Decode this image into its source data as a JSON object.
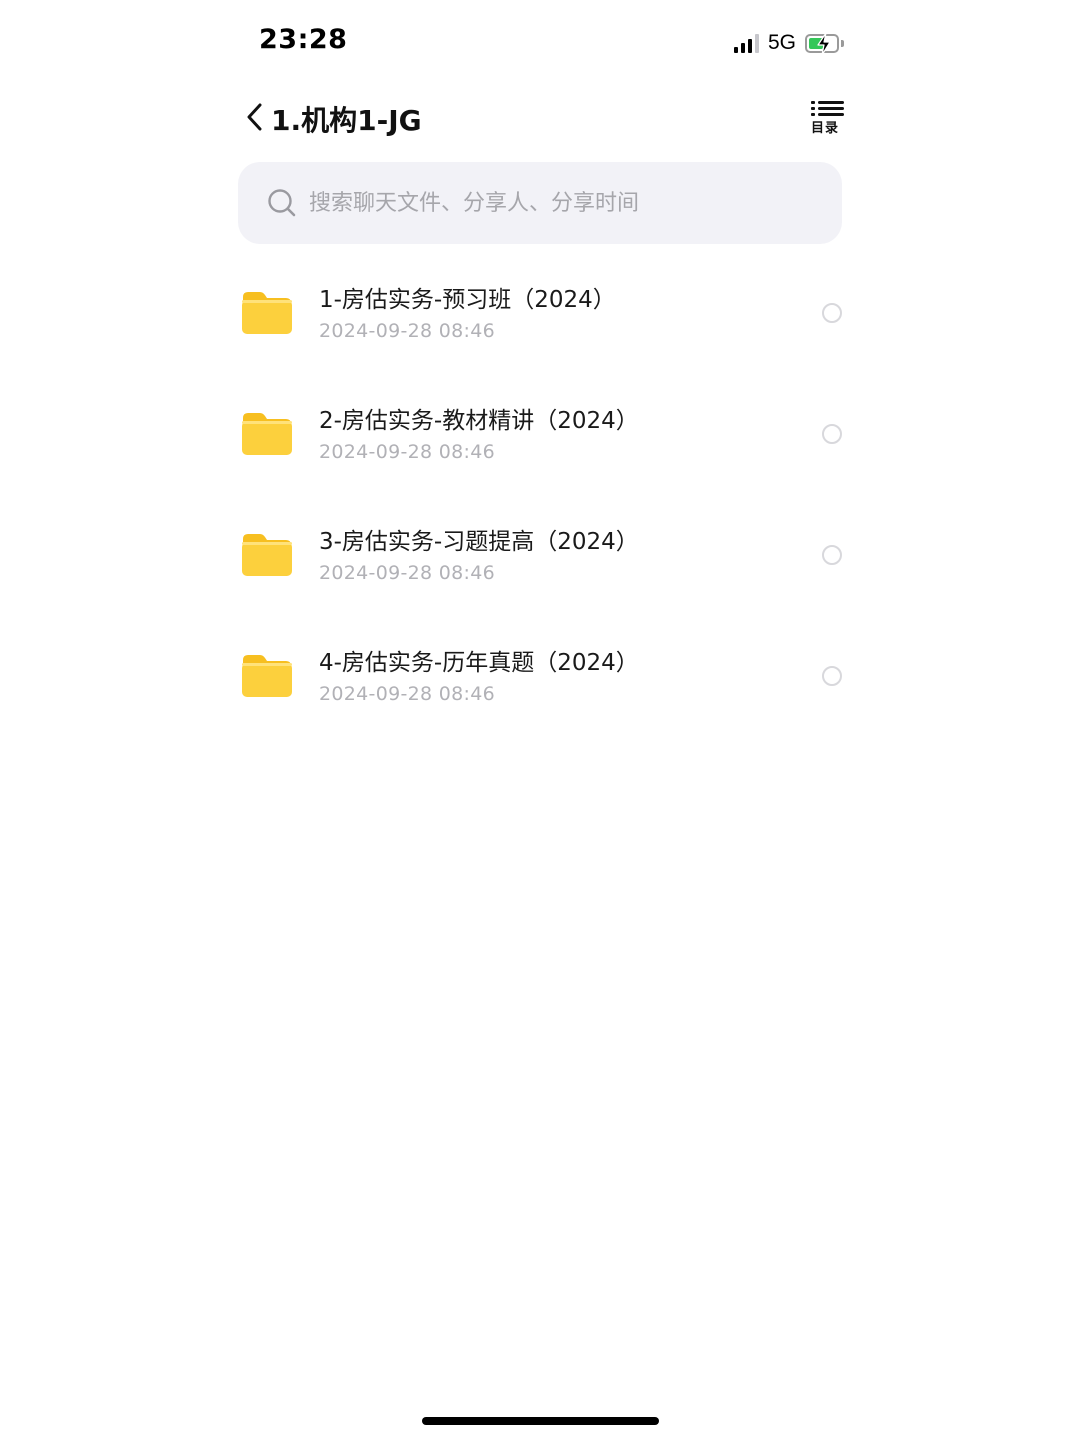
{
  "status_bar": {
    "time": "23:28",
    "network": "5G",
    "battery_charging": true
  },
  "header": {
    "back_icon": "chevron-left-icon",
    "title": "1.机构1-JG",
    "toc_icon": "list-icon",
    "toc_label": "目录"
  },
  "search": {
    "placeholder": "搜索聊天文件、分享人、分享时间",
    "value": ""
  },
  "files": [
    {
      "name": "1-房估实务-预习班（2024）",
      "date": "2024-09-28 08:46",
      "icon": "folder-icon",
      "selected": false
    },
    {
      "name": "2-房估实务-教材精讲（2024）",
      "date": "2024-09-28 08:46",
      "icon": "folder-icon",
      "selected": false
    },
    {
      "name": "3-房估实务-习题提高（2024）",
      "date": "2024-09-28 08:46",
      "icon": "folder-icon",
      "selected": false
    },
    {
      "name": "4-房估实务-历年真题（2024）",
      "date": "2024-09-28 08:46",
      "icon": "folder-icon",
      "selected": false
    }
  ],
  "colors": {
    "folder": "#fcd03d",
    "folder_tab": "#f7bf20",
    "search_bg": "#f2f2f7",
    "date_text": "#b1b1b6",
    "battery_fill": "#34c759"
  }
}
